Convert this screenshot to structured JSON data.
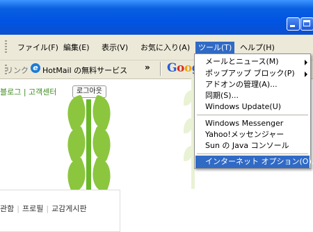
{
  "menubar": {
    "items": [
      "ファイル(F)",
      "編集(E)",
      "表示(V)",
      "お気に入り(A)",
      "ツール(T)",
      "ヘルプ(H)"
    ]
  },
  "linksbar": {
    "label": "リンク",
    "link_text": "HotMail の無料サービス",
    "chevron": "»",
    "google": {
      "part1": "G",
      "part2": "o",
      "part3": "o",
      "part4": "g"
    }
  },
  "page": {
    "links": "블로그 | 고객센터",
    "logout": "로그아웃",
    "bottom_nav": [
      "관함",
      "프로필",
      "교감게시판"
    ]
  },
  "tools_menu": {
    "items": [
      {
        "label": "メールとニュース(M)",
        "submenu": true
      },
      {
        "label": "ポップアップ ブロック(P)",
        "submenu": true
      },
      {
        "label": "アドオンの管理(A)...",
        "submenu": false
      },
      {
        "label": "同期(S)...",
        "submenu": false
      },
      {
        "label": "Windows Update(U)",
        "submenu": false
      },
      {
        "label": "Windows Messenger",
        "submenu": false
      },
      {
        "label": "Yahoo!メッセンジャー",
        "submenu": false
      },
      {
        "label": "Sun の Java コンソール",
        "submenu": false
      },
      {
        "label": "インターネット オプション(O)...",
        "submenu": false,
        "selected": true
      }
    ]
  },
  "colors": {
    "selection": "#316ac5",
    "toolbar": "#ece9d8",
    "leaf": "#8cc63f",
    "titlebar": "#0054e3"
  }
}
